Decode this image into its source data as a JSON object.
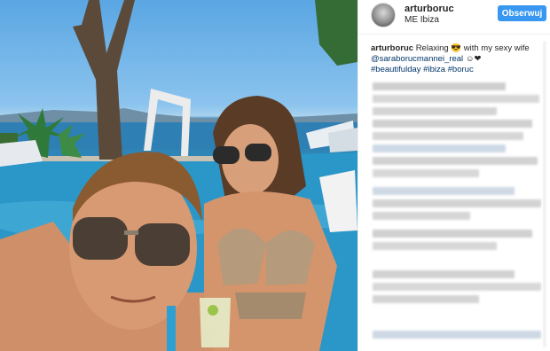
{
  "post": {
    "username": "arturboruc",
    "location": "ME Ibiza",
    "follow_label": "Obserwuj"
  },
  "caption": {
    "author": "arturboruc",
    "text": "Relaxing 😎 with my sexy wife",
    "mention": "@saraborucmannei_real",
    "emoji": "☺❤",
    "hashtags": [
      "#beautifulday",
      "#ibiza",
      "#boruc"
    ]
  },
  "comments": {
    "state": "blurred"
  },
  "colors": {
    "accent": "#3897f0",
    "link": "#003569",
    "text": "#262626"
  },
  "icons": [
    "sunglasses-emoji",
    "smile-emoji",
    "heart-emoji"
  ]
}
